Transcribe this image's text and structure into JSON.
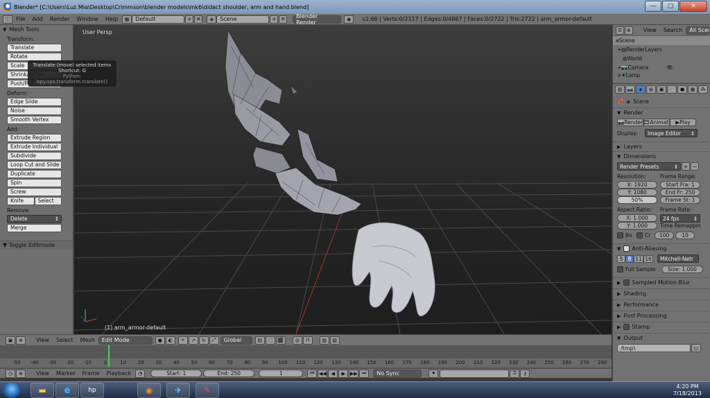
{
  "window": {
    "title": "Blender* [C:\\Users\\Luz Mia\\Desktop\\Crimmson\\blender models\\mk6\\didact shoulder, arm and hand.blend]",
    "minimize": "—",
    "maximize": "□",
    "close": "✕"
  },
  "info_header": {
    "menus": [
      "File",
      "Add",
      "Render",
      "Window",
      "Help"
    ],
    "screen_layout": "Default",
    "scene": "Scene",
    "engine": "Blender Render",
    "stats": "v2.66 | Verts:0/2117 | Edges:0/4867 | Faces:0/2722 | Tris:2722 | arm_armor-default"
  },
  "toolshelf": {
    "title": "Mesh Tools",
    "transform_label": "Transform:",
    "transform": [
      "Translate",
      "Rotate",
      "Scale",
      "Shrink/Fatten",
      "Push/Pull"
    ],
    "deform_label": "Deform:",
    "deform": [
      "Edge Slide",
      "Noise",
      "Smooth Vertex"
    ],
    "add_label": "Add:",
    "add": [
      "Extrude Region",
      "Extrude Individual",
      "Subdivide",
      "Loop Cut and Slide",
      "Duplicate",
      "Spin",
      "Screw"
    ],
    "knife": "Knife",
    "select": "Select",
    "remove_label": "Remove:",
    "delete": "Delete",
    "merge": "Merge",
    "toggle_editmode": "Toggle Editmode"
  },
  "tooltip": {
    "line1": "Translate (move) selected items",
    "line2": "Shortcut: G",
    "line3": "Python: bpy.ops.transform.translate()"
  },
  "viewport": {
    "view_label": "User Persp",
    "object_label": "(1) arm_armor-default"
  },
  "view3d_header": {
    "menus": [
      "View",
      "Select",
      "Mesh"
    ],
    "mode": "Edit Mode",
    "orientation": "Global"
  },
  "timeline": {
    "ticks": [
      "-50",
      "-40",
      "-30",
      "-20",
      "-10",
      "0",
      "10",
      "20",
      "30",
      "40",
      "50",
      "60",
      "70",
      "80",
      "90",
      "100",
      "110",
      "120",
      "130",
      "140",
      "150",
      "160",
      "170",
      "180",
      "190",
      "200",
      "210",
      "220",
      "230",
      "240",
      "250",
      "260",
      "270",
      "280"
    ],
    "current_frame": 1,
    "menus": [
      "View",
      "Marker",
      "Frame",
      "Playback"
    ],
    "start": "Start: 1",
    "end": "End: 250",
    "frame": "1",
    "sync": "No Sync"
  },
  "outliner": {
    "view": "View",
    "search": "Search",
    "filter": "All Scenes",
    "rows": [
      "Scene",
      "RenderLayers",
      "World",
      "Camera",
      "Lamp"
    ]
  },
  "properties": {
    "context": "Scene",
    "render_title": "Render",
    "render_btn": "Render",
    "animation_btn": "Animati",
    "play_btn": "Play",
    "display_label": "Display:",
    "display_value": "Image Editor",
    "layers_title": "Layers",
    "dimensions_title": "Dimensions",
    "render_presets": "Render Presets",
    "resolution_label": "Resolution:",
    "res_x": "X: 1920",
    "res_y": "Y: 1080",
    "res_pct": "50%",
    "frame_range_label": "Frame Range:",
    "start_frame": "Start Fra: 1",
    "end_frame": "End Fr: 250",
    "frame_step": "Frame St: 1",
    "aspect_label": "Aspect Ratio:",
    "aspect_x": "X: 1.000",
    "aspect_y": "Y: 1.000",
    "frame_rate_label": "Frame Rate:",
    "fps": "24 fps",
    "time_remap_label": "Time Remappin",
    "remap_old": "·100·",
    "remap_new": "·10·",
    "border_label": "Bo",
    "crop_label": "Cr",
    "aa_title": "Anti-Aliasing",
    "aa_samples": [
      "5",
      "8",
      "11",
      "16"
    ],
    "aa_filter": "Mitchell-Netr",
    "full_sample": "Full Sample",
    "size": "Size: 1.000",
    "motion_blur": "Sampled Motion Blur",
    "shading": "Shading",
    "performance": "Performance",
    "post_processing": "Post Processing",
    "stamp": "Stamp",
    "output": "Output",
    "output_path": "/tmp\\"
  },
  "taskbar": {
    "time": "4:20 PM",
    "date": "7/18/2013"
  }
}
